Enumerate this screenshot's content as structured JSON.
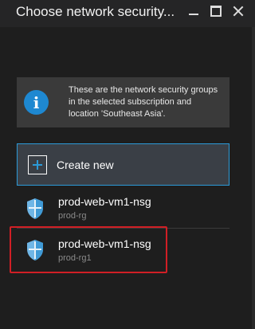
{
  "header": {
    "title": "Choose network security..."
  },
  "info": {
    "icon": "info-icon",
    "text": "These are the network security groups in the selected subscription and location 'Southeast Asia'."
  },
  "create": {
    "label": "Create new",
    "icon": "plus-icon"
  },
  "items": [
    {
      "name": "prod-web-vm1-nsg",
      "resource_group": "prod-rg",
      "icon": "shield-icon"
    },
    {
      "name": "prod-web-vm1-nsg",
      "resource_group": "prod-rg1",
      "icon": "shield-icon"
    }
  ],
  "colors": {
    "background": "#1e1e1e",
    "accent": "#2b9ad8",
    "info_icon": "#1e88d1",
    "highlight": "#d11f25"
  }
}
